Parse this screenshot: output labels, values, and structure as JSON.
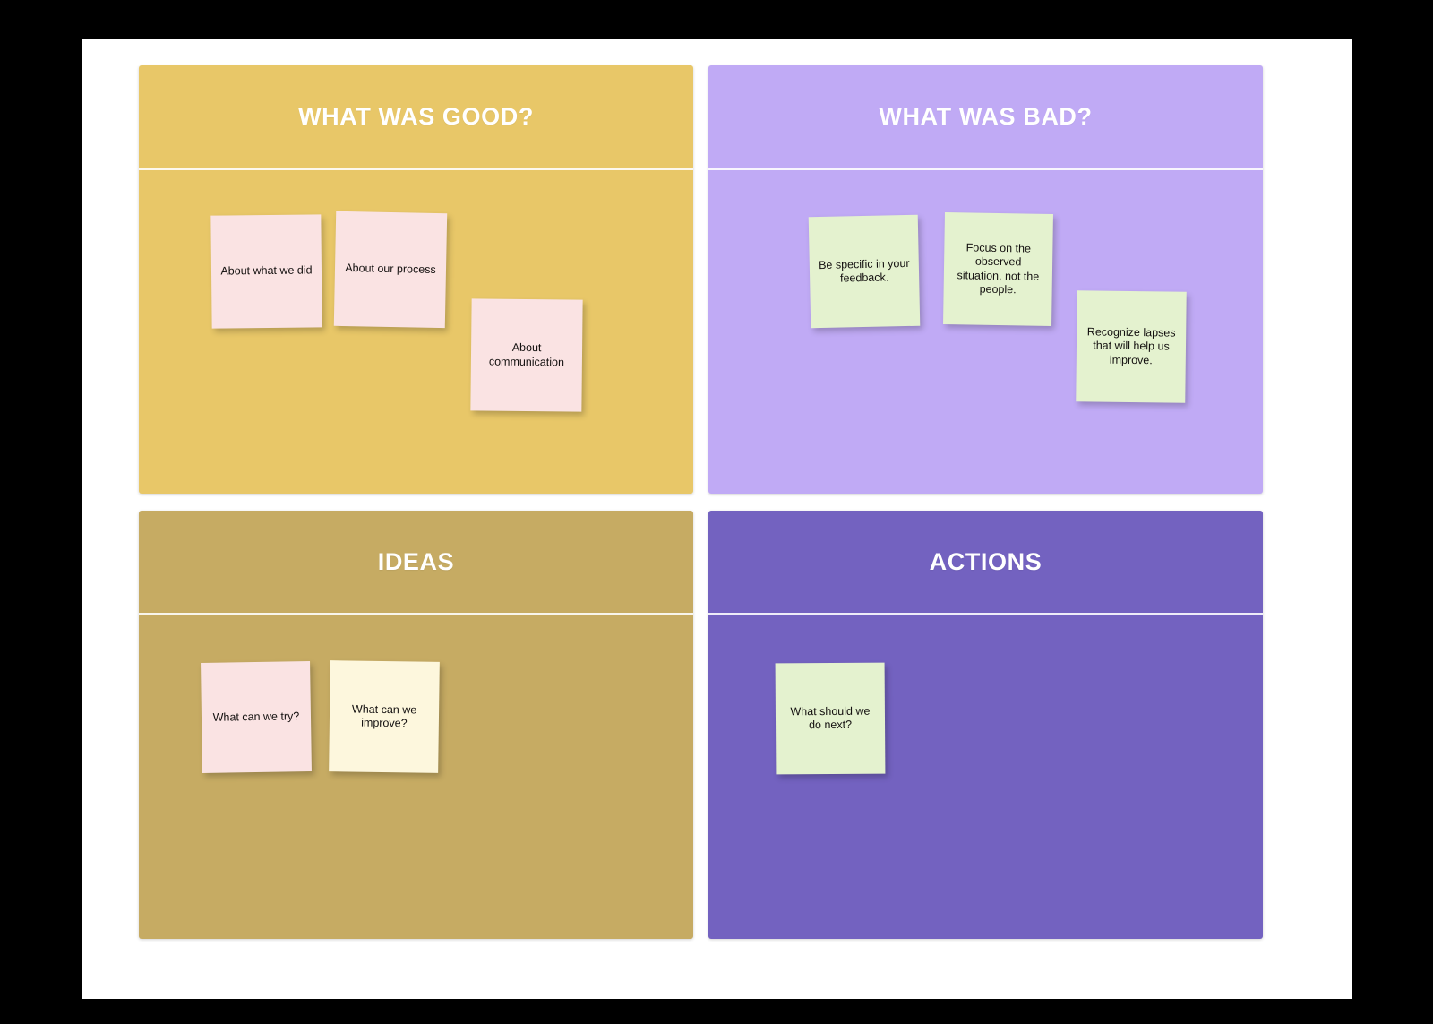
{
  "board": {
    "background_color": "#000000",
    "page_color": "#ffffff",
    "quadrants": [
      {
        "id": "what-was-good",
        "title": "WHAT WAS GOOD?",
        "color": "#e8c768",
        "notes": [
          {
            "text": "About what we did",
            "color": "#fae3e3"
          },
          {
            "text": "About our process",
            "color": "#fae3e3"
          },
          {
            "text": "About communication",
            "color": "#fae3e3"
          }
        ]
      },
      {
        "id": "what-was-bad",
        "title": "WHAT WAS BAD?",
        "color": "#c0aaf5",
        "notes": [
          {
            "text": "Be specific in your feedback.",
            "color": "#e4f2cf"
          },
          {
            "text": "Focus on the observed situation, not the people.",
            "color": "#e4f2cf"
          },
          {
            "text": "Recognize lapses that will help us improve.",
            "color": "#e4f2cf"
          }
        ]
      },
      {
        "id": "ideas",
        "title": "IDEAS",
        "color": "#c6ab63",
        "notes": [
          {
            "text": "What can we try?",
            "color": "#fae3e3"
          },
          {
            "text": "What can we improve?",
            "color": "#fdf7dd"
          }
        ]
      },
      {
        "id": "actions",
        "title": "ACTIONS",
        "color": "#7362c0",
        "notes": [
          {
            "text": "What should we do next?",
            "color": "#e4f2cf"
          }
        ]
      }
    ]
  }
}
